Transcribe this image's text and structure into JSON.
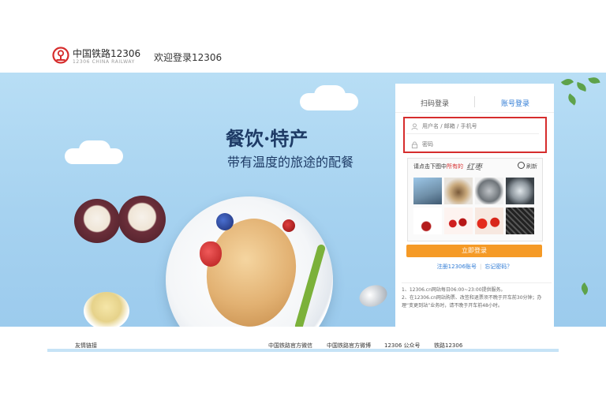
{
  "header": {
    "logo_cn": "中国铁路12306",
    "logo_en": "12306 CHINA RAILWAY",
    "welcome": "欢迎登录12306"
  },
  "banner": {
    "title": "餐饮·特产",
    "subtitle": "带有温度的旅途的配餐"
  },
  "login": {
    "tab_qr": "扫码登录",
    "tab_account": "账号登录",
    "username_placeholder": "用户名 / 邮箱 / 手机号",
    "password_placeholder": "密码",
    "captcha_prompt_pre": "请点击下图中",
    "captcha_prompt_kw": "所有的",
    "captcha_word": "红枣",
    "refresh": "刷新",
    "submit": "立即登录",
    "register": "注册12306账号",
    "forgot": "忘记密码？",
    "notice_1": "1、12306.cn网站每日06:00~23:00提供服务。",
    "notice_2": "2、在12306.cn网站购票、改签和退票须不晚于开车前30分钟；办理“变更到站”业务时，请不晚于开车前48小时。"
  },
  "footer": {
    "label": "友情链接",
    "links": [
      "中国铁路官方微信",
      "中国铁路官方微博",
      "12306 公众号",
      "铁路12306"
    ]
  },
  "colors": {
    "accent_orange": "#f59a26",
    "link_blue": "#2f7bd5",
    "highlight_red": "#d62d2d",
    "banner_blue": "#a6d2f0",
    "title_navy": "#1e3b66"
  }
}
